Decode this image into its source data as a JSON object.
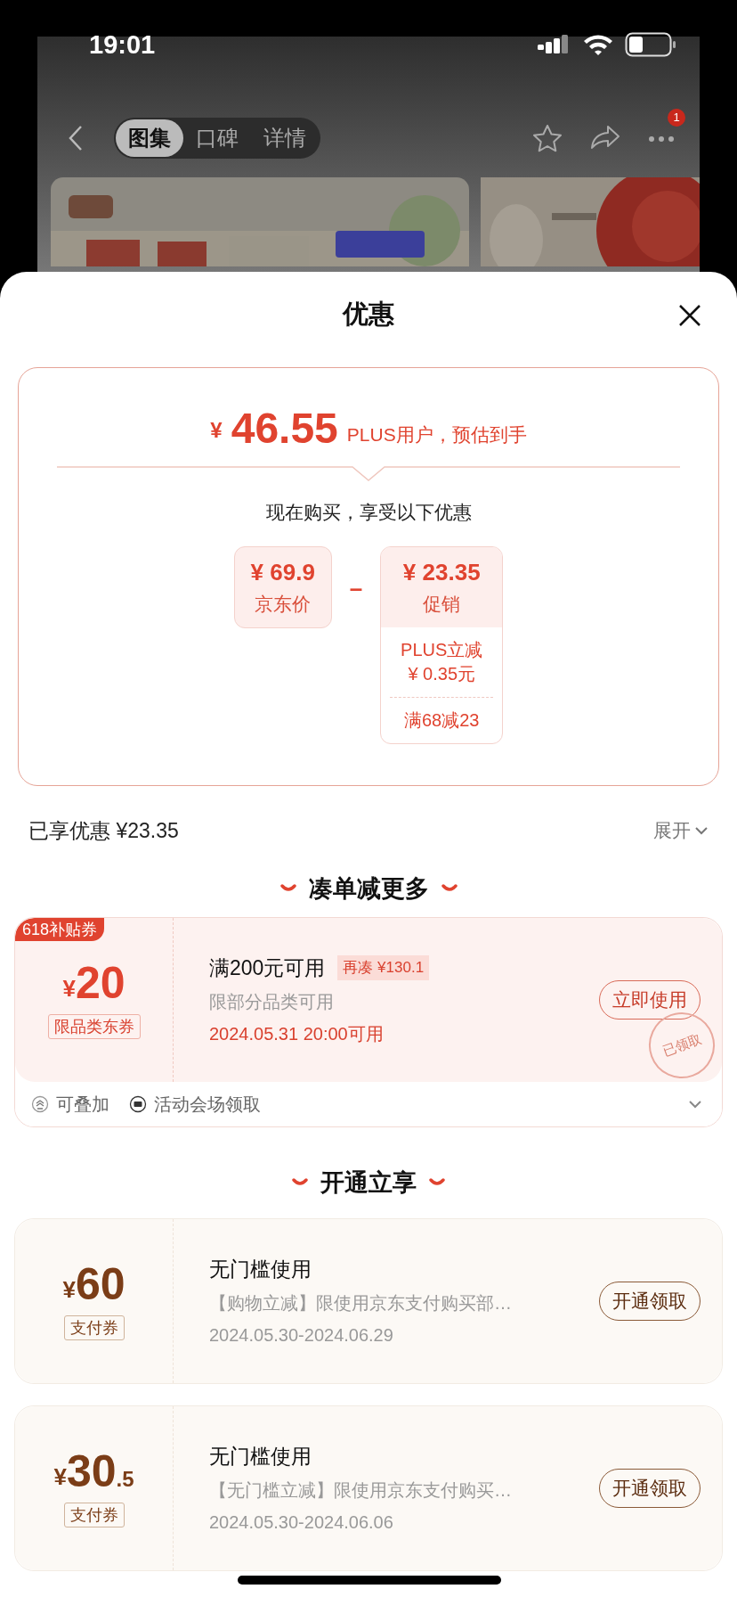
{
  "status_bar": {
    "time": "19:01"
  },
  "nav": {
    "tabs": [
      {
        "label": "图集",
        "selected": true
      },
      {
        "label": "口碑",
        "selected": false
      },
      {
        "label": "详情",
        "selected": false
      }
    ],
    "more_badge": "1"
  },
  "sheet": {
    "title": "优惠"
  },
  "price_card": {
    "currency": "¥",
    "price": "46.55",
    "note": "PLUS用户，预估到手",
    "subtitle": "现在购买，享受以下优惠",
    "base": {
      "amount": "¥ 69.9",
      "label": "京东价"
    },
    "operator": "–",
    "discount": {
      "amount": "¥ 23.35",
      "label": "促销",
      "items": [
        {
          "lines": [
            "PLUS立减",
            "¥ 0.35元"
          ]
        },
        {
          "lines": [
            "满68减23"
          ]
        }
      ]
    }
  },
  "enjoyed": {
    "label": "已享优惠 ¥23.35",
    "toggle": "展开"
  },
  "sections": [
    {
      "title": "凑单减更多",
      "coupons": [
        {
          "kind": "subsidy",
          "corner_tag": "618补贴券",
          "currency": "¥",
          "amount": "20",
          "type_tag": "限品类东券",
          "title": "满200元可用",
          "gap_tag": "再凑 ¥130.1",
          "desc": "限部分品类可用",
          "date": "2024.05.31 20:00可用",
          "button": "立即使用",
          "stamp": "已领取",
          "footer": [
            {
              "kind": "stackable",
              "text": "可叠加"
            },
            {
              "kind": "venue",
              "text": "活动会场领取"
            }
          ],
          "expandable": true
        }
      ]
    },
    {
      "title": "开通立享",
      "coupons": [
        {
          "kind": "pay",
          "currency": "¥",
          "amount": "60",
          "type_tag": "支付券",
          "title": "无门槛使用",
          "desc": "【购物立减】限使用京东支付购买部…",
          "date": "2024.05.30-2024.06.29",
          "button": "开通领取"
        },
        {
          "kind": "pay",
          "currency": "¥",
          "amount": "30",
          "decimal": ".5",
          "type_tag": "支付券",
          "title": "无门槛使用",
          "desc": "【无门槛立减】限使用京东支付购买…",
          "date": "2024.05.30-2024.06.06",
          "button": "开通领取"
        }
      ]
    }
  ]
}
